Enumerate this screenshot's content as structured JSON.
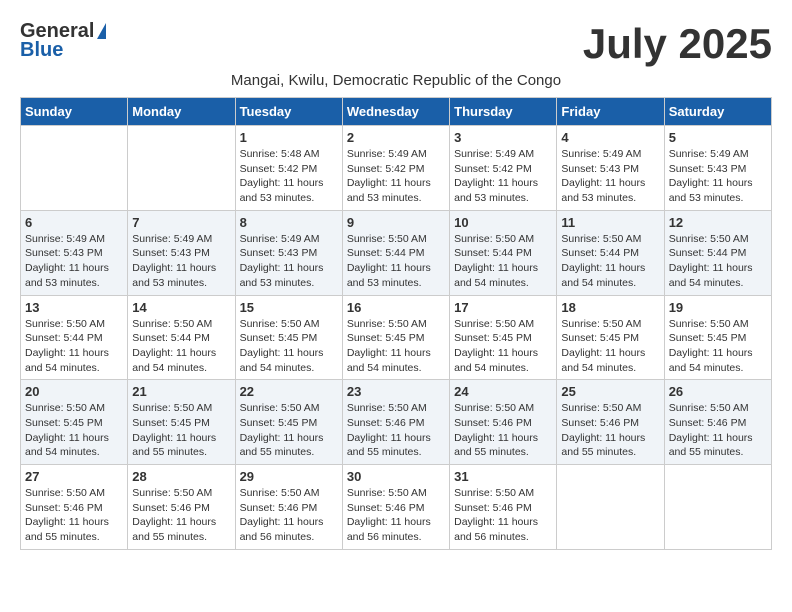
{
  "header": {
    "logo_general": "General",
    "logo_blue": "Blue",
    "month": "July 2025",
    "subtitle": "Mangai, Kwilu, Democratic Republic of the Congo"
  },
  "weekdays": [
    "Sunday",
    "Monday",
    "Tuesday",
    "Wednesday",
    "Thursday",
    "Friday",
    "Saturday"
  ],
  "weeks": [
    [
      {
        "day": "",
        "info": ""
      },
      {
        "day": "",
        "info": ""
      },
      {
        "day": "1",
        "info": "Sunrise: 5:48 AM\nSunset: 5:42 PM\nDaylight: 11 hours and 53 minutes."
      },
      {
        "day": "2",
        "info": "Sunrise: 5:49 AM\nSunset: 5:42 PM\nDaylight: 11 hours and 53 minutes."
      },
      {
        "day": "3",
        "info": "Sunrise: 5:49 AM\nSunset: 5:42 PM\nDaylight: 11 hours and 53 minutes."
      },
      {
        "day": "4",
        "info": "Sunrise: 5:49 AM\nSunset: 5:43 PM\nDaylight: 11 hours and 53 minutes."
      },
      {
        "day": "5",
        "info": "Sunrise: 5:49 AM\nSunset: 5:43 PM\nDaylight: 11 hours and 53 minutes."
      }
    ],
    [
      {
        "day": "6",
        "info": "Sunrise: 5:49 AM\nSunset: 5:43 PM\nDaylight: 11 hours and 53 minutes."
      },
      {
        "day": "7",
        "info": "Sunrise: 5:49 AM\nSunset: 5:43 PM\nDaylight: 11 hours and 53 minutes."
      },
      {
        "day": "8",
        "info": "Sunrise: 5:49 AM\nSunset: 5:43 PM\nDaylight: 11 hours and 53 minutes."
      },
      {
        "day": "9",
        "info": "Sunrise: 5:50 AM\nSunset: 5:44 PM\nDaylight: 11 hours and 53 minutes."
      },
      {
        "day": "10",
        "info": "Sunrise: 5:50 AM\nSunset: 5:44 PM\nDaylight: 11 hours and 54 minutes."
      },
      {
        "day": "11",
        "info": "Sunrise: 5:50 AM\nSunset: 5:44 PM\nDaylight: 11 hours and 54 minutes."
      },
      {
        "day": "12",
        "info": "Sunrise: 5:50 AM\nSunset: 5:44 PM\nDaylight: 11 hours and 54 minutes."
      }
    ],
    [
      {
        "day": "13",
        "info": "Sunrise: 5:50 AM\nSunset: 5:44 PM\nDaylight: 11 hours and 54 minutes."
      },
      {
        "day": "14",
        "info": "Sunrise: 5:50 AM\nSunset: 5:44 PM\nDaylight: 11 hours and 54 minutes."
      },
      {
        "day": "15",
        "info": "Sunrise: 5:50 AM\nSunset: 5:45 PM\nDaylight: 11 hours and 54 minutes."
      },
      {
        "day": "16",
        "info": "Sunrise: 5:50 AM\nSunset: 5:45 PM\nDaylight: 11 hours and 54 minutes."
      },
      {
        "day": "17",
        "info": "Sunrise: 5:50 AM\nSunset: 5:45 PM\nDaylight: 11 hours and 54 minutes."
      },
      {
        "day": "18",
        "info": "Sunrise: 5:50 AM\nSunset: 5:45 PM\nDaylight: 11 hours and 54 minutes."
      },
      {
        "day": "19",
        "info": "Sunrise: 5:50 AM\nSunset: 5:45 PM\nDaylight: 11 hours and 54 minutes."
      }
    ],
    [
      {
        "day": "20",
        "info": "Sunrise: 5:50 AM\nSunset: 5:45 PM\nDaylight: 11 hours and 54 minutes."
      },
      {
        "day": "21",
        "info": "Sunrise: 5:50 AM\nSunset: 5:45 PM\nDaylight: 11 hours and 55 minutes."
      },
      {
        "day": "22",
        "info": "Sunrise: 5:50 AM\nSunset: 5:45 PM\nDaylight: 11 hours and 55 minutes."
      },
      {
        "day": "23",
        "info": "Sunrise: 5:50 AM\nSunset: 5:46 PM\nDaylight: 11 hours and 55 minutes."
      },
      {
        "day": "24",
        "info": "Sunrise: 5:50 AM\nSunset: 5:46 PM\nDaylight: 11 hours and 55 minutes."
      },
      {
        "day": "25",
        "info": "Sunrise: 5:50 AM\nSunset: 5:46 PM\nDaylight: 11 hours and 55 minutes."
      },
      {
        "day": "26",
        "info": "Sunrise: 5:50 AM\nSunset: 5:46 PM\nDaylight: 11 hours and 55 minutes."
      }
    ],
    [
      {
        "day": "27",
        "info": "Sunrise: 5:50 AM\nSunset: 5:46 PM\nDaylight: 11 hours and 55 minutes."
      },
      {
        "day": "28",
        "info": "Sunrise: 5:50 AM\nSunset: 5:46 PM\nDaylight: 11 hours and 55 minutes."
      },
      {
        "day": "29",
        "info": "Sunrise: 5:50 AM\nSunset: 5:46 PM\nDaylight: 11 hours and 56 minutes."
      },
      {
        "day": "30",
        "info": "Sunrise: 5:50 AM\nSunset: 5:46 PM\nDaylight: 11 hours and 56 minutes."
      },
      {
        "day": "31",
        "info": "Sunrise: 5:50 AM\nSunset: 5:46 PM\nDaylight: 11 hours and 56 minutes."
      },
      {
        "day": "",
        "info": ""
      },
      {
        "day": "",
        "info": ""
      }
    ]
  ]
}
